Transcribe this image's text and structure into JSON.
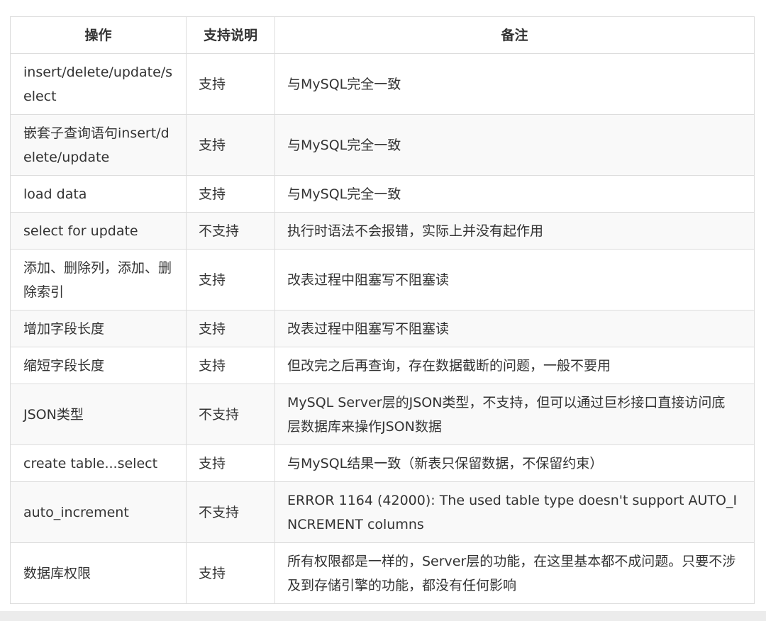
{
  "table": {
    "headers": [
      "操作",
      "支持说明",
      "备注"
    ],
    "rows": [
      {
        "op": "insert/delete/update/select",
        "support": "支持",
        "note": "与MySQL完全一致",
        "tall": true
      },
      {
        "op": "嵌套子查询语句insert/delete/update",
        "support": "支持",
        "note": "与MySQL完全一致",
        "tall": true
      },
      {
        "op": "load data",
        "support": "支持",
        "note": "与MySQL完全一致",
        "tall": false
      },
      {
        "op": "select for update",
        "support": "不支持",
        "note": "执行时语法不会报错，实际上并没有起作用",
        "tall": false
      },
      {
        "op": "添加、删除列，添加、删除索引",
        "support": "支持",
        "note": "改表过程中阻塞写不阻塞读",
        "tall": true
      },
      {
        "op": "增加字段长度",
        "support": "支持",
        "note": "改表过程中阻塞写不阻塞读",
        "tall": false
      },
      {
        "op": "缩短字段长度",
        "support": "支持",
        "note": "但改完之后再查询，存在数据截断的问题，一般不要用",
        "tall": false
      },
      {
        "op": "JSON类型",
        "support": "不支持",
        "note": "MySQL Server层的JSON类型，不支持，但可以通过巨杉接口直接访问底层数据库来操作JSON数据",
        "tall": true
      },
      {
        "op": "create table...select",
        "support": "支持",
        "note": "与MySQL结果一致（新表只保留数据，不保留约束）",
        "tall": false
      },
      {
        "op": "auto_increment",
        "support": "不支持",
        "note": "ERROR 1164 (42000): The used table type doesn't support AUTO_INCREMENT columns",
        "tall": true
      },
      {
        "op": "数据库权限",
        "support": "支持",
        "note": "所有权限都是一样的，Server层的功能，在这里基本都不成问题。只要不涉及到存储引擎的功能，都没有任何影响",
        "tall": true
      }
    ]
  }
}
